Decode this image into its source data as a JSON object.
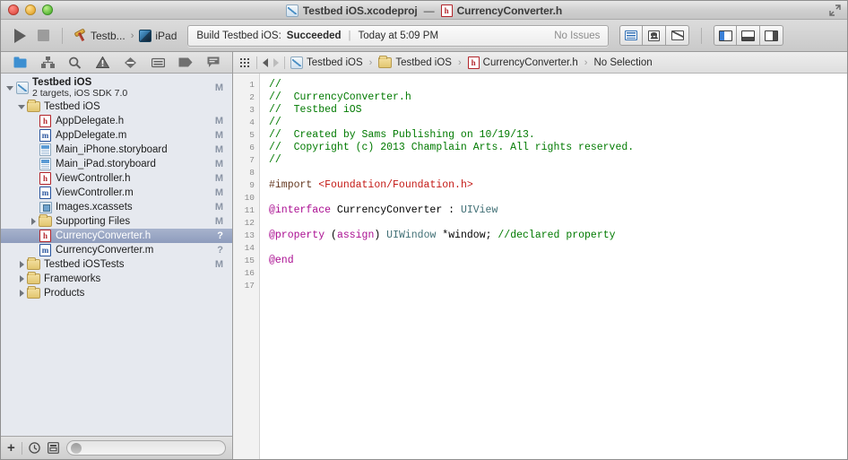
{
  "window": {
    "title_project": "Testbed iOS.xcodeproj",
    "title_dash": "—",
    "title_file": "CurrencyConverter.h",
    "traffic": [
      "close",
      "minimize",
      "zoom"
    ]
  },
  "toolbar": {
    "run_label": "Run",
    "stop_label": "Stop",
    "scheme_name": "Testb...",
    "scheme_chevron": "›",
    "destination": "iPad",
    "status": {
      "build_prefix": "Build Testbed iOS: ",
      "build_result": "Succeeded",
      "divider": "|",
      "time": "Today at 5:09 PM",
      "issues": "No Issues"
    },
    "editor_modes": [
      "standard-editor",
      "assistant-editor",
      "version-editor"
    ],
    "view_toggles": [
      "navigator-toggle",
      "debug-area-toggle",
      "utilities-toggle"
    ]
  },
  "navigator": {
    "tabs": [
      "project-navigator",
      "symbol-navigator",
      "search-navigator",
      "issue-navigator",
      "test-navigator",
      "debug-navigator",
      "breakpoint-navigator",
      "log-navigator"
    ],
    "tree": [
      {
        "label": "Testbed iOS",
        "sub": "2 targets, iOS SDK 7.0",
        "icon": "xcodeproj",
        "badge": "M",
        "indent": 0,
        "disclosure": "open",
        "bold": true,
        "selected": false
      },
      {
        "label": "Testbed iOS",
        "sub": "",
        "icon": "folder",
        "badge": "",
        "indent": 1,
        "disclosure": "open",
        "bold": false,
        "selected": false
      },
      {
        "label": "AppDelegate.h",
        "sub": "",
        "icon": "h",
        "badge": "M",
        "indent": 2,
        "disclosure": "none",
        "bold": false,
        "selected": false
      },
      {
        "label": "AppDelegate.m",
        "sub": "",
        "icon": "m",
        "badge": "M",
        "indent": 2,
        "disclosure": "none",
        "bold": false,
        "selected": false
      },
      {
        "label": "Main_iPhone.storyboard",
        "sub": "",
        "icon": "storyboard",
        "badge": "M",
        "indent": 2,
        "disclosure": "none",
        "bold": false,
        "selected": false
      },
      {
        "label": "Main_iPad.storyboard",
        "sub": "",
        "icon": "storyboard",
        "badge": "M",
        "indent": 2,
        "disclosure": "none",
        "bold": false,
        "selected": false
      },
      {
        "label": "ViewController.h",
        "sub": "",
        "icon": "h",
        "badge": "M",
        "indent": 2,
        "disclosure": "none",
        "bold": false,
        "selected": false
      },
      {
        "label": "ViewController.m",
        "sub": "",
        "icon": "m",
        "badge": "M",
        "indent": 2,
        "disclosure": "none",
        "bold": false,
        "selected": false
      },
      {
        "label": "Images.xcassets",
        "sub": "",
        "icon": "xcassets",
        "badge": "M",
        "indent": 2,
        "disclosure": "none",
        "bold": false,
        "selected": false
      },
      {
        "label": "Supporting Files",
        "sub": "",
        "icon": "folder",
        "badge": "M",
        "indent": 2,
        "disclosure": "closed",
        "bold": false,
        "selected": false
      },
      {
        "label": "CurrencyConverter.h",
        "sub": "",
        "icon": "h",
        "badge": "?",
        "indent": 2,
        "disclosure": "none",
        "bold": false,
        "selected": true
      },
      {
        "label": "CurrencyConverter.m",
        "sub": "",
        "icon": "m",
        "badge": "?",
        "indent": 2,
        "disclosure": "none",
        "bold": false,
        "selected": false
      },
      {
        "label": "Testbed iOSTests",
        "sub": "",
        "icon": "folder",
        "badge": "M",
        "indent": 1,
        "disclosure": "closed",
        "bold": false,
        "selected": false
      },
      {
        "label": "Frameworks",
        "sub": "",
        "icon": "folder",
        "badge": "",
        "indent": 1,
        "disclosure": "closed",
        "bold": false,
        "selected": false
      },
      {
        "label": "Products",
        "sub": "",
        "icon": "folder",
        "badge": "",
        "indent": 1,
        "disclosure": "closed",
        "bold": false,
        "selected": false
      }
    ],
    "filter": {
      "add_label": "+",
      "recent_icon": "clock-icon",
      "source-control_icon": "source-control-icon",
      "placeholder": ""
    }
  },
  "editor": {
    "jump_bar": {
      "related_items_icon": "related-items-icon",
      "back_label": "Back",
      "forward_label": "Forward",
      "crumbs": [
        {
          "label": "Testbed iOS",
          "icon": "xcodeproj"
        },
        {
          "label": "Testbed iOS",
          "icon": "folder"
        },
        {
          "label": "CurrencyConverter.h",
          "icon": "h"
        },
        {
          "label": "No Selection",
          "icon": "none"
        }
      ],
      "separator": "›"
    },
    "line_numbers": [
      "1",
      "2",
      "3",
      "4",
      "5",
      "6",
      "7",
      "8",
      "9",
      "10",
      "11",
      "12",
      "13",
      "14",
      "15",
      "16",
      "17"
    ],
    "code_lines": [
      [
        {
          "t": "//",
          "c": "c-com"
        }
      ],
      [
        {
          "t": "//  CurrencyConverter.h",
          "c": "c-com"
        }
      ],
      [
        {
          "t": "//  Testbed iOS",
          "c": "c-com"
        }
      ],
      [
        {
          "t": "//",
          "c": "c-com"
        }
      ],
      [
        {
          "t": "//  Created by Sams Publishing on 10/19/13.",
          "c": "c-com"
        }
      ],
      [
        {
          "t": "//  Copyright (c) 2013 Champlain Arts. All rights reserved.",
          "c": "c-com"
        }
      ],
      [
        {
          "t": "//",
          "c": "c-com"
        }
      ],
      [
        {
          "t": "",
          "c": "c-pln"
        }
      ],
      [
        {
          "t": "#import ",
          "c": "c-pre"
        },
        {
          "t": "<Foundation/Foundation.h>",
          "c": "c-str"
        }
      ],
      [
        {
          "t": "",
          "c": "c-pln"
        }
      ],
      [
        {
          "t": "@interface",
          "c": "c-kw"
        },
        {
          "t": " CurrencyConverter : ",
          "c": "c-pln"
        },
        {
          "t": "UIView",
          "c": "c-cls"
        }
      ],
      [
        {
          "t": "",
          "c": "c-pln"
        }
      ],
      [
        {
          "t": "@property",
          "c": "c-kw"
        },
        {
          "t": " (",
          "c": "c-pln"
        },
        {
          "t": "assign",
          "c": "c-kw"
        },
        {
          "t": ") ",
          "c": "c-pln"
        },
        {
          "t": "UIWindow",
          "c": "c-cls"
        },
        {
          "t": " *window; ",
          "c": "c-pln"
        },
        {
          "t": "//declared property",
          "c": "c-com"
        }
      ],
      [
        {
          "t": "",
          "c": "c-pln"
        }
      ],
      [
        {
          "t": "@end",
          "c": "c-kw"
        }
      ],
      [
        {
          "t": "",
          "c": "c-pln"
        }
      ],
      [
        {
          "t": "",
          "c": "c-pln"
        }
      ]
    ]
  }
}
